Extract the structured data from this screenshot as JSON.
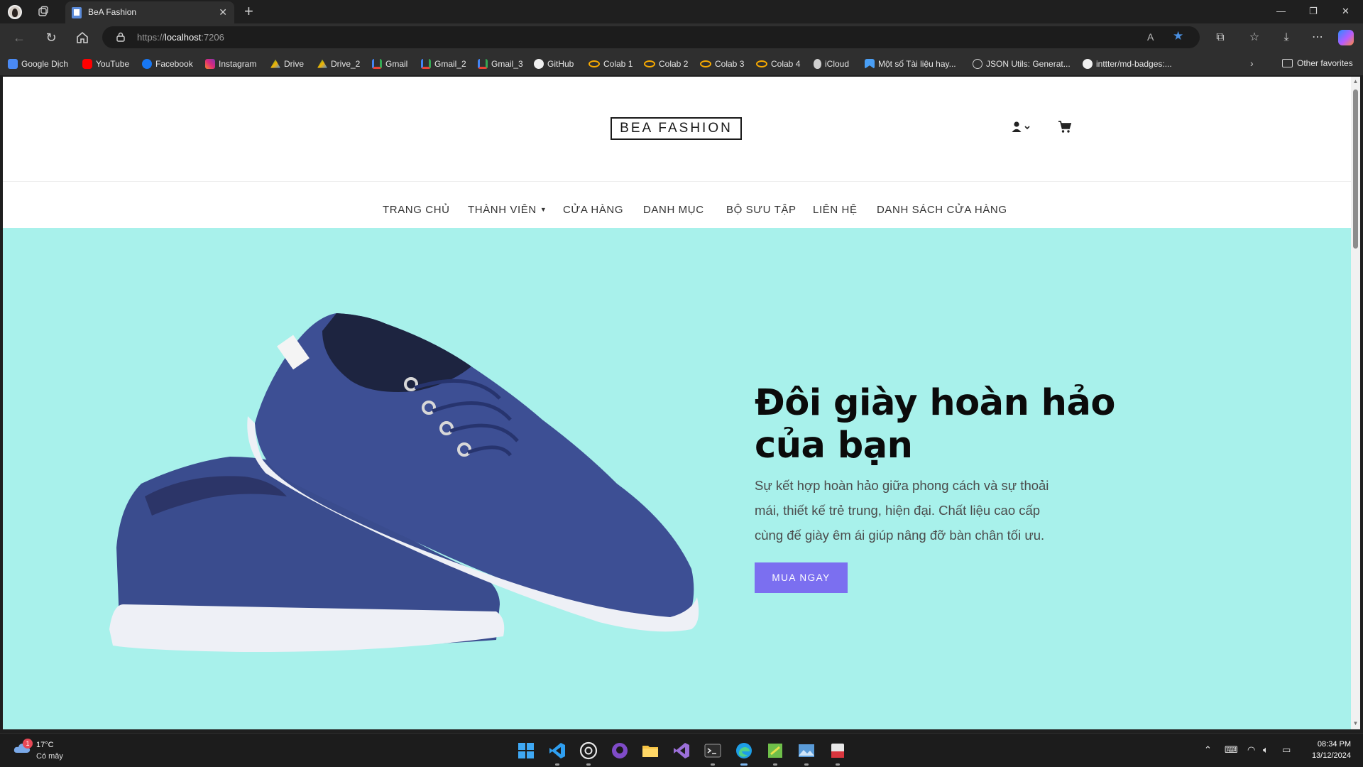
{
  "browser": {
    "tab": {
      "title": "BeA Fashion",
      "close": "✕"
    },
    "new_tab": "+",
    "window_controls": {
      "minimize": "—",
      "restore": "❐",
      "close": "✕"
    },
    "address": {
      "scheme": "https://",
      "host": "localhost",
      "port": ":7206"
    },
    "favorites": [
      {
        "label": "Google Dịch",
        "icon": "google-translate-icon",
        "color": "#4a8af4"
      },
      {
        "label": "YouTube",
        "icon": "youtube-icon",
        "color": "#ff0000"
      },
      {
        "label": "Facebook",
        "icon": "facebook-icon",
        "color": "#1877f2"
      },
      {
        "label": "Instagram",
        "icon": "instagram-icon",
        "color": "#e1306c"
      },
      {
        "label": "Drive",
        "icon": "drive-icon",
        "color": "#f4b400"
      },
      {
        "label": "Drive_2",
        "icon": "drive-icon",
        "color": "#0f9d58"
      },
      {
        "label": "Gmail",
        "icon": "gmail-icon",
        "color": "#ea4335"
      },
      {
        "label": "Gmail_2",
        "icon": "gmail-icon",
        "color": "#ea4335"
      },
      {
        "label": "Gmail_3",
        "icon": "gmail-icon",
        "color": "#ea4335"
      },
      {
        "label": "GitHub",
        "icon": "github-icon",
        "color": "#ffffff"
      },
      {
        "label": "Colab 1",
        "icon": "colab-icon",
        "color": "#f9ab00"
      },
      {
        "label": "Colab 2",
        "icon": "colab-icon",
        "color": "#f9ab00"
      },
      {
        "label": "Colab 3",
        "icon": "colab-icon",
        "color": "#f9ab00"
      },
      {
        "label": "Colab 4",
        "icon": "colab-icon",
        "color": "#f9ab00"
      },
      {
        "label": "iCloud",
        "icon": "apple-icon",
        "color": "#cfcfcf"
      },
      {
        "label": "Một số Tài liệu hay...",
        "icon": "bookmark-icon",
        "color": "#4a9ff5"
      },
      {
        "label": "JSON Utils: Generat...",
        "icon": "globe-icon",
        "color": "#d0d0d0"
      },
      {
        "label": "inttter/md-badges:...",
        "icon": "github-icon",
        "color": "#ffffff"
      }
    ],
    "other_favorites": "Other favorites"
  },
  "site": {
    "logo": "BEA FASHION",
    "nav": [
      {
        "label": "TRANG CHỦ",
        "dropdown": false
      },
      {
        "label": "THÀNH VIÊN",
        "dropdown": true
      },
      {
        "label": "CỬA HÀNG",
        "dropdown": false
      },
      {
        "label": "DANH MỤC",
        "dropdown": false
      },
      {
        "label": "BỘ SƯU TẬP",
        "dropdown": false
      },
      {
        "label": "LIÊN HỆ",
        "dropdown": false
      },
      {
        "label": "DANH SÁCH CỬA HÀNG",
        "dropdown": false
      }
    ],
    "hero": {
      "title": "Đôi giày hoàn hảo của bạn",
      "description": "Sự kết hợp hoàn hảo giữa phong cách và sự thoải mái, thiết kế trẻ trung, hiện đại. Chất liệu cao cấp cùng đế giày êm ái giúp nâng đỡ bàn chân tối ưu.",
      "button": "MUA NGAY",
      "background_color": "#a8f1eb",
      "button_color": "#7b6ff0"
    }
  },
  "taskbar": {
    "weather": {
      "temp": "17°C",
      "condition": "Có mây",
      "badge": "1"
    },
    "apps": [
      "windows-start-icon",
      "vscode-icon",
      "chatgpt-icon",
      "github-desktop-icon",
      "file-explorer-icon",
      "visual-studio-icon",
      "terminal-icon",
      "edge-icon",
      "sql-tool-icon",
      "photos-icon",
      "app-icon"
    ],
    "clock": {
      "time": "08:34 PM",
      "date": "13/12/2024"
    }
  }
}
